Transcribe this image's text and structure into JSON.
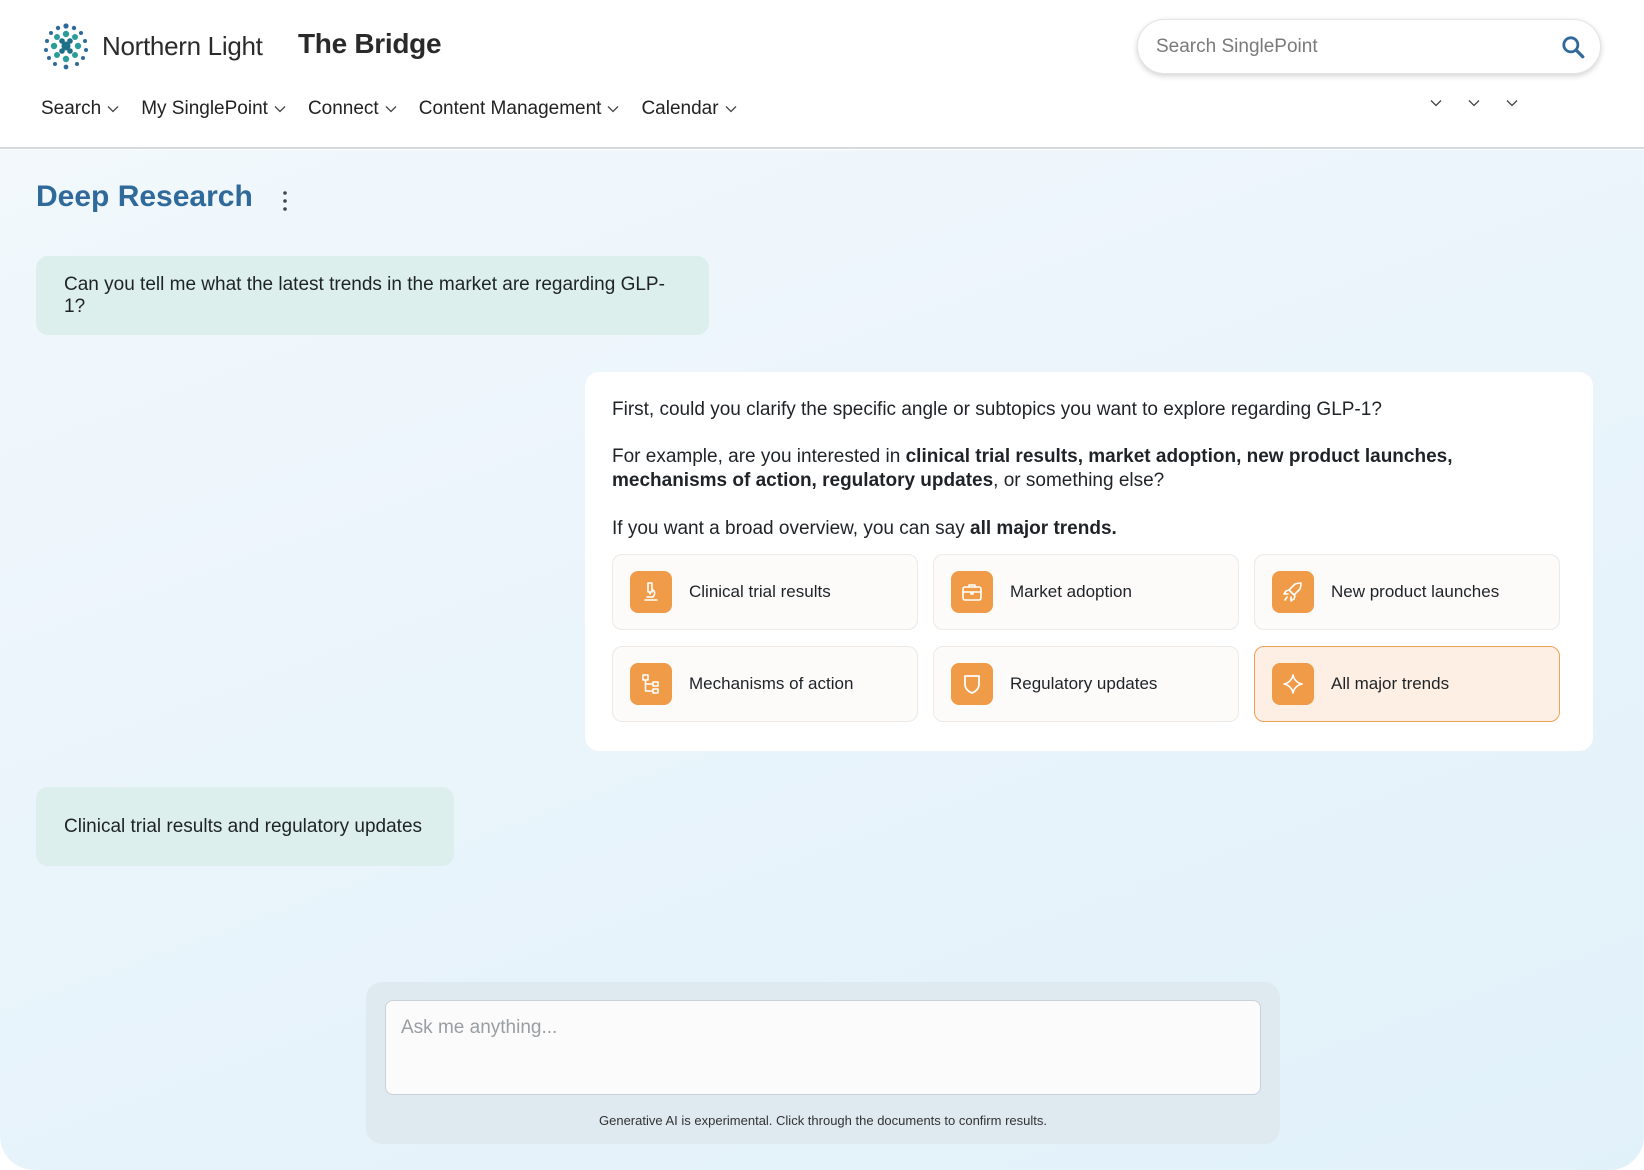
{
  "header": {
    "logo_text": "Northern Light",
    "app_title": "The Bridge",
    "search": {
      "placeholder": "Search SinglePoint",
      "icon": "search-icon"
    }
  },
  "nav": {
    "items": [
      {
        "label": "Search"
      },
      {
        "label": "My SinglePoint"
      },
      {
        "label": "Connect"
      },
      {
        "label": "Content Management"
      },
      {
        "label": "Calendar"
      }
    ],
    "icons": [
      "user-icon",
      "help-icon",
      "mail-icon"
    ]
  },
  "page": {
    "title": "Deep Research"
  },
  "conversation": {
    "user_message_1": "Can you tell me what the latest trends in the market are regarding GLP-1?",
    "assistant": {
      "p1": "First, could you clarify the specific angle or subtopics you want to explore regarding GLP-1?",
      "p2_prefix": "For example, are you interested in ",
      "p2_bold": "clinical trial results, market adoption, new product launches, mechanisms of action, regulatory updates",
      "p2_suffix": ", or something else?",
      "p3_prefix": "If you want a broad overview, you can say ",
      "p3_bold": "all major trends."
    },
    "options": [
      {
        "label": "Clinical trial results",
        "icon": "microscope-icon"
      },
      {
        "label": "Market adoption",
        "icon": "briefcase-icon"
      },
      {
        "label": "New product launches",
        "icon": "rocket-icon"
      },
      {
        "label": "Mechanisms of action",
        "icon": "hierarchy-icon"
      },
      {
        "label": "Regulatory updates",
        "icon": "shield-icon"
      },
      {
        "label": "All major trends",
        "icon": "sparkle-icon",
        "selected": true
      }
    ],
    "user_message_2": "Clinical trial results and regulatory updates"
  },
  "composer": {
    "placeholder": "Ask me anything...",
    "disclaimer": "Generative AI is experimental. Click through the documents to confirm results."
  },
  "colors": {
    "accent_orange": "#ef9b47",
    "title_blue": "#2f6a9a",
    "user_bubble": "#dcefed"
  }
}
